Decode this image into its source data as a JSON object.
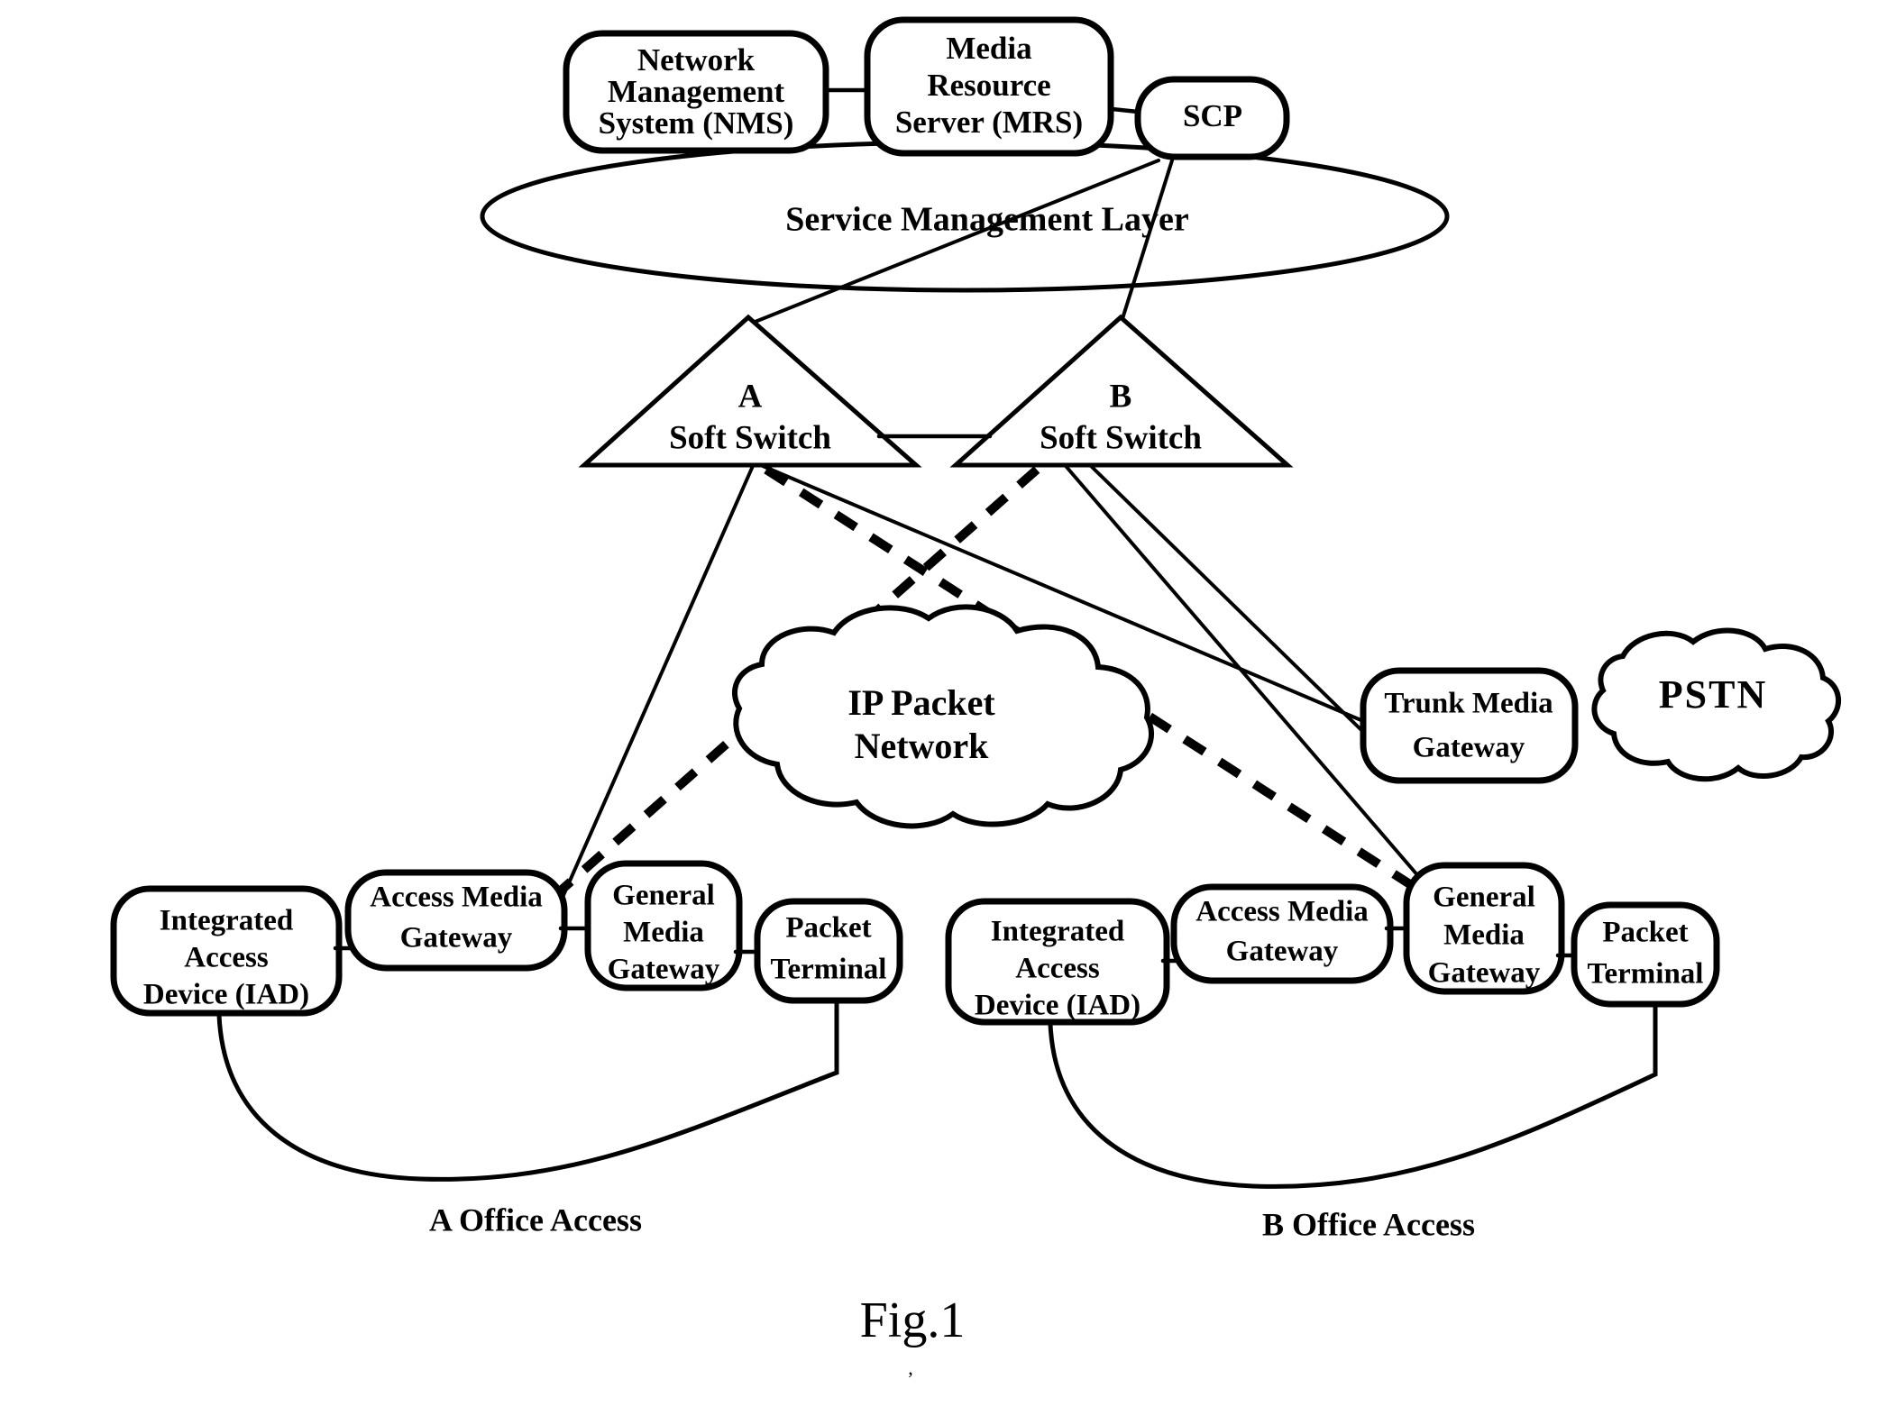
{
  "figure": {
    "caption": "Fig.1",
    "layer_label": "Service Management Layer",
    "office_left_label": "A Office Access",
    "office_right_label": "B Office Access"
  },
  "service_layer": {
    "nms": {
      "line1": "Network",
      "line2": "Management",
      "line3": "System (NMS)"
    },
    "mrs": {
      "line1": "Media",
      "line2": "Resource",
      "line3": "Server (MRS)"
    },
    "scp": {
      "label": "SCP"
    }
  },
  "switches": {
    "a": {
      "letter": "A",
      "label": "Soft Switch"
    },
    "b": {
      "letter": "B",
      "label": "Soft Switch"
    }
  },
  "networks": {
    "ip_packet": {
      "line1": "IP Packet",
      "line2": "Network"
    },
    "pstn": {
      "label": "PSTN"
    }
  },
  "trunk_gateway": {
    "line1": "Trunk Media",
    "line2": "Gateway"
  },
  "office_a": {
    "iad": {
      "line1": "Integrated",
      "line2": "Access",
      "line3": "Device (IAD)"
    },
    "access_media_gateway": {
      "line1": "Access Media",
      "line2": "Gateway"
    },
    "general_media_gateway": {
      "line1": "General",
      "line2": "Media",
      "line3": "Gateway"
    },
    "packet_terminal": {
      "line1": "Packet",
      "line2": "Terminal"
    }
  },
  "office_b": {
    "iad": {
      "line1": "Integrated",
      "line2": "Access",
      "line3": "Device (IAD)"
    },
    "access_media_gateway": {
      "line1": "Access Media",
      "line2": "Gateway"
    },
    "general_media_gateway": {
      "line1": "General",
      "line2": "Media",
      "line3": "Gateway"
    },
    "packet_terminal": {
      "line1": "Packet",
      "line2": "Terminal"
    }
  },
  "colors": {
    "stroke": "#000000",
    "background": "#ffffff"
  }
}
